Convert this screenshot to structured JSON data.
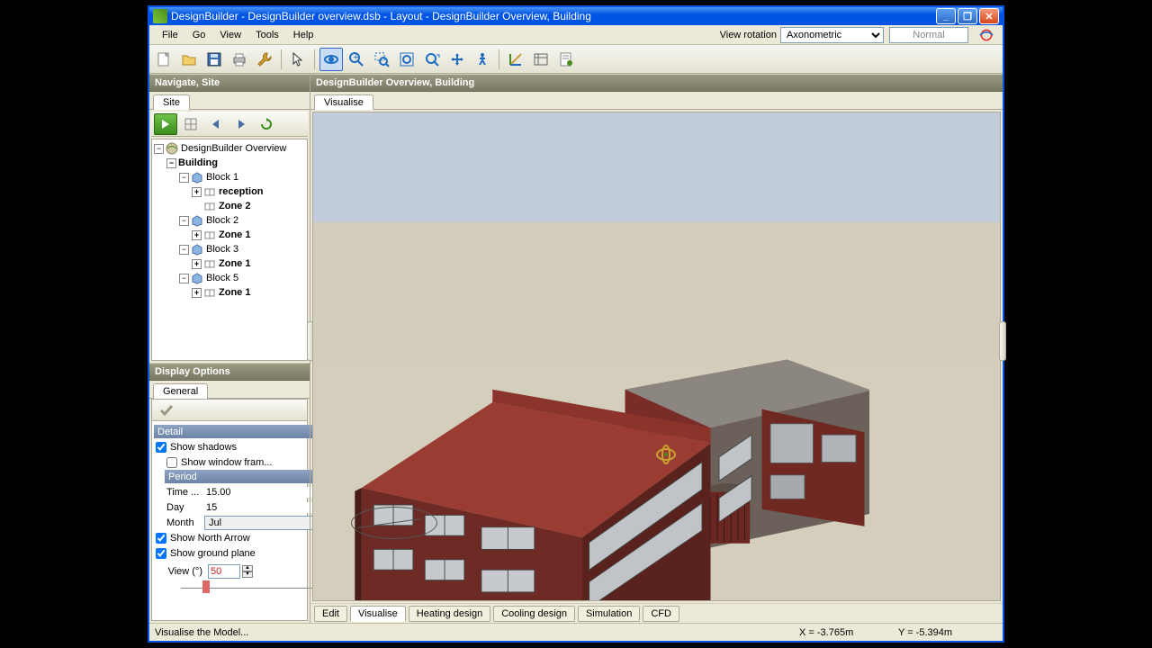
{
  "window": {
    "title": "DesignBuilder - DesignBuilder overview.dsb - Layout - DesignBuilder Overview, Building"
  },
  "menu": {
    "file": "File",
    "go": "Go",
    "view": "View",
    "tools": "Tools",
    "help": "Help"
  },
  "view_rotation": {
    "label": "View rotation",
    "value": "Axonometric",
    "normal": "Normal"
  },
  "sidebar": {
    "nav_title": "Navigate, Site",
    "nav_tab": "Site",
    "tree": {
      "root": "DesignBuilder Overview",
      "building": "Building",
      "block1": "Block 1",
      "block1_reception": "reception",
      "block1_zone2": "Zone 2",
      "block2": "Block 2",
      "block2_zone1": "Zone 1",
      "block3": "Block 3",
      "block3_zone1": "Zone 1",
      "block5": "Block 5",
      "block5_zone1": "Zone 1"
    },
    "display_title": "Display Options",
    "display_tab": "General",
    "detail_label": "Detail",
    "show_shadows": "Show shadows",
    "show_window_frame": "Show window fram...",
    "period_label": "Period",
    "time_label": "Time ...",
    "time_value": "15.00",
    "day_label": "Day",
    "day_value": "15",
    "month_label": "Month",
    "month_value": "Jul",
    "show_north": "Show North Arrow",
    "show_ground": "Show ground plane",
    "view_label": "View (°)",
    "view_value": "50"
  },
  "main": {
    "header": "DesignBuilder Overview, Building",
    "tab": "Visualise"
  },
  "bottom_tabs": {
    "edit": "Edit",
    "visualise": "Visualise",
    "heating": "Heating design",
    "cooling": "Cooling design",
    "simulation": "Simulation",
    "cfd": "CFD"
  },
  "status": {
    "msg": "Visualise the Model...",
    "x": "X = -3.765m",
    "y": "Y = -5.394m"
  }
}
